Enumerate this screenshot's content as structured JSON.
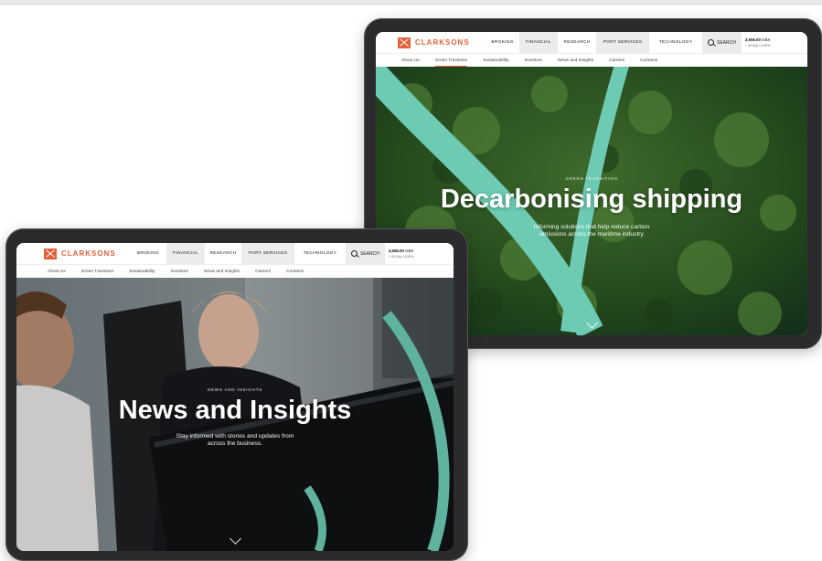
{
  "brand": {
    "name": "CLARKSONS",
    "accent": "#e4603b",
    "teal": "#6dcbb4"
  },
  "nav": {
    "items": [
      "BROKING",
      "FINANCIAL",
      "RESEARCH",
      "PORT SERVICES",
      "TECHNOLOGY"
    ],
    "search_label": "SEARCH",
    "price_value": "3,555.00",
    "price_currency": "GBX",
    "price_sub": "+ 00.00p • 0.00%"
  },
  "subnav": {
    "items": [
      "About Us",
      "Green Transition",
      "Sustainability",
      "Investors",
      "News and Insights",
      "Careers",
      "Contacts"
    ]
  },
  "tablet_back": {
    "active_subnav": "Green Transition",
    "eyebrow": "GREEN TRANSITION",
    "headline": "Decarbonising shipping",
    "desc_line1": "Informing solutions that help reduce carbon",
    "desc_line2": "emissions across the maritime industry"
  },
  "tablet_front": {
    "eyebrow": "NEWS AND INSIGHTS",
    "headline": "News and Insights",
    "desc_line1": "Stay informed with stories and updates from",
    "desc_line2": "across the business."
  },
  "icons": {
    "search": "search-icon",
    "scroll": "chevron-down-icon",
    "logo": "clarksons-logo-icon"
  }
}
